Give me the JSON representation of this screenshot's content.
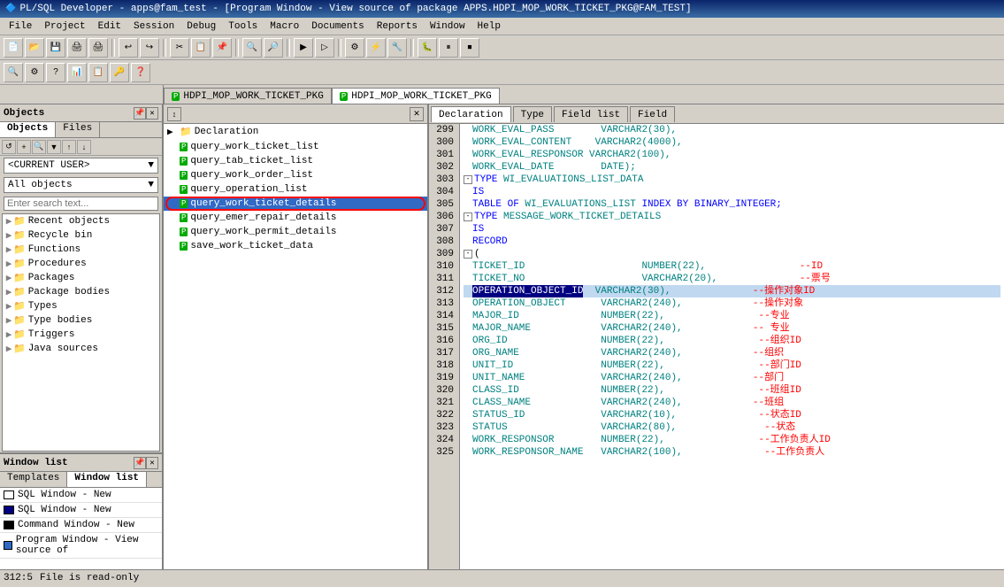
{
  "titleBar": {
    "text": "PL/SQL Developer - apps@fam_test - [Program Window - View source of package APPS.HDPI_MOP_WORK_TICKET_PKG@FAM_TEST]"
  },
  "menuBar": {
    "items": [
      "File",
      "Project",
      "Edit",
      "Session",
      "Debug",
      "Tools",
      "Macro",
      "Documents",
      "Reports",
      "Window",
      "Help"
    ]
  },
  "tabs": [
    {
      "label": "HDPI_MOP_WORK_TICKET_PKG",
      "active": false
    },
    {
      "label": "HDPI_MOP_WORK_TICKET_PKG",
      "active": true
    }
  ],
  "leftPanel": {
    "title": "Objects",
    "tabs": [
      "Objects",
      "Files"
    ],
    "currentUser": "<CURRENT USER>",
    "allObjects": "All objects",
    "searchPlaceholder": "Enter search text...",
    "treeItems": [
      {
        "label": "Recent objects",
        "type": "folder",
        "indent": 0,
        "expanded": false
      },
      {
        "label": "Recycle bin",
        "type": "folder",
        "indent": 0,
        "expanded": false
      },
      {
        "label": "Functions",
        "type": "folder",
        "indent": 0,
        "expanded": false
      },
      {
        "label": "Procedures",
        "type": "folder",
        "indent": 0,
        "expanded": false
      },
      {
        "label": "Packages",
        "type": "folder",
        "indent": 0,
        "expanded": false
      },
      {
        "label": "Package bodies",
        "type": "folder",
        "indent": 0,
        "expanded": false
      },
      {
        "label": "Types",
        "type": "folder",
        "indent": 0,
        "expanded": false
      },
      {
        "label": "Type bodies",
        "type": "folder",
        "indent": 0,
        "expanded": false
      },
      {
        "label": "Triggers",
        "type": "folder",
        "indent": 0,
        "expanded": false
      },
      {
        "label": "Java sources",
        "type": "folder",
        "indent": 0,
        "expanded": false
      }
    ]
  },
  "windowList": {
    "title": "Window list",
    "tabs": [
      "Templates",
      "Window list"
    ],
    "items": [
      {
        "label": "SQL Window - New",
        "type": "sql"
      },
      {
        "label": "SQL Window - New",
        "type": "sql"
      },
      {
        "label": "Command Window - New",
        "type": "cmd"
      },
      {
        "label": "Program Window - View source of",
        "type": "prog"
      }
    ]
  },
  "codeTree": {
    "items": [
      {
        "label": "Declaration",
        "type": "folder"
      },
      {
        "label": "query_work_ticket_list",
        "type": "pkg"
      },
      {
        "label": "query_tab_ticket_list",
        "type": "pkg"
      },
      {
        "label": "query_work_order_list",
        "type": "pkg"
      },
      {
        "label": "query_operation_list",
        "type": "pkg"
      },
      {
        "label": "query_work_ticket_details",
        "type": "pkg",
        "selected": true,
        "highlighted": true
      },
      {
        "label": "query_emer_repair_details",
        "type": "pkg"
      },
      {
        "label": "query_work_permit_details",
        "type": "pkg"
      },
      {
        "label": "save_work_ticket_data",
        "type": "pkg"
      }
    ]
  },
  "declTabs": [
    "Declaration",
    "Type",
    "Field list",
    "Field"
  ],
  "codeLines": [
    {
      "num": 299,
      "indent": "        ",
      "content": "WORK_EVAL_PASS",
      "after": "        VARCHAR2(30),",
      "kwColor": false
    },
    {
      "num": 300,
      "indent": "        ",
      "content": "WORK_EVAL_CONTENT",
      "after": "    VARCHAR2(4000),",
      "kwColor": false
    },
    {
      "num": 301,
      "indent": "        ",
      "content": "WORK_EVAL_RESPONSOR",
      "after": " VARCHAR2(100),",
      "kwColor": false
    },
    {
      "num": 302,
      "indent": "        ",
      "content": "WORK_EVAL_DATE",
      "after": "        DATE);",
      "kwColor": false
    },
    {
      "num": 303,
      "indent": "  ",
      "content": "TYPE WI_EVALUATIONS_LIST_DATA",
      "after": "",
      "kwColor": true,
      "collapse": true
    },
    {
      "num": 304,
      "indent": "  ",
      "content": "IS",
      "after": "",
      "kwColor": true
    },
    {
      "num": 305,
      "indent": "    ",
      "content": "TABLE OF WI_EVALUATIONS_LIST INDEX BY BINARY_INTEGER;",
      "after": "",
      "kwColor": true
    },
    {
      "num": 306,
      "indent": "  ",
      "content": "TYPE MESSAGE_WORK_TICKET_DETAILS",
      "after": "",
      "kwColor": true,
      "collapse": true
    },
    {
      "num": 307,
      "indent": "  ",
      "content": "IS",
      "after": "",
      "kwColor": true
    },
    {
      "num": 308,
      "indent": "  ",
      "content": "  RECORD",
      "after": "",
      "kwColor": true
    },
    {
      "num": 309,
      "indent": "  ",
      "content": "(",
      "after": "",
      "kwColor": false,
      "collapse": true
    },
    {
      "num": 310,
      "indent": "    ",
      "content": "TICKET_ID",
      "mid": "                    ",
      "type": "NUMBER(22),",
      "comment": "--ID"
    },
    {
      "num": 311,
      "indent": "    ",
      "content": "TICKET_NO",
      "mid": "                    ",
      "type": "VARCHAR2(20),",
      "comment": "--票号"
    },
    {
      "num": 312,
      "indent": "    ",
      "content": "OPERATION_OBJECT_ID",
      "mid": "  ",
      "type": "VARCHAR2(30),",
      "comment": "--操作对象ID",
      "highlighted": true
    },
    {
      "num": 313,
      "indent": "    ",
      "content": "OPERATION_OBJECT",
      "mid": "      ",
      "type": "VARCHAR2(240),",
      "comment": "--操作对象"
    },
    {
      "num": 314,
      "indent": "    ",
      "content": "MAJOR_ID",
      "mid": "              ",
      "type": "NUMBER(22),",
      "comment": "--专业"
    },
    {
      "num": 315,
      "indent": "    ",
      "content": "MAJOR_NAME",
      "mid": "            ",
      "type": "VARCHAR2(240),",
      "comment": "--专业"
    },
    {
      "num": 316,
      "indent": "    ",
      "content": "ORG_ID",
      "mid": "                ",
      "type": "NUMBER(22),",
      "comment": "--组织ID"
    },
    {
      "num": 317,
      "indent": "    ",
      "content": "ORG_NAME",
      "mid": "              ",
      "type": "VARCHAR2(240),",
      "comment": "--组织"
    },
    {
      "num": 318,
      "indent": "    ",
      "content": "UNIT_ID",
      "mid": "               ",
      "type": "NUMBER(22),",
      "comment": "--部门ID"
    },
    {
      "num": 319,
      "indent": "    ",
      "content": "UNIT_NAME",
      "mid": "             ",
      "type": "VARCHAR2(240),",
      "comment": "--部门"
    },
    {
      "num": 320,
      "indent": "    ",
      "content": "CLASS_ID",
      "mid": "              ",
      "type": "NUMBER(22),",
      "comment": "--班组ID"
    },
    {
      "num": 321,
      "indent": "    ",
      "content": "CLASS_NAME",
      "mid": "            ",
      "type": "VARCHAR2(240),",
      "comment": "--班组"
    },
    {
      "num": 322,
      "indent": "    ",
      "content": "STATUS_ID",
      "mid": "             ",
      "type": "VARCHAR2(10),",
      "comment": "--状态ID"
    },
    {
      "num": 323,
      "indent": "    ",
      "content": "STATUS",
      "mid": "                ",
      "type": "VARCHAR2(80),",
      "comment": "--状态"
    },
    {
      "num": 324,
      "indent": "    ",
      "content": "WORK_RESPONSOR",
      "mid": "        ",
      "type": "NUMBER(22),",
      "comment": "--工作负责人ID"
    },
    {
      "num": 325,
      "indent": "    ",
      "content": "WORK_RESPONSOR_NAME",
      "mid": "   ",
      "type": "VARCHAR2(100),",
      "comment": "--工作负责人"
    }
  ],
  "statusBar": {
    "position": "312:5",
    "fileStatus": "File is read-only"
  }
}
